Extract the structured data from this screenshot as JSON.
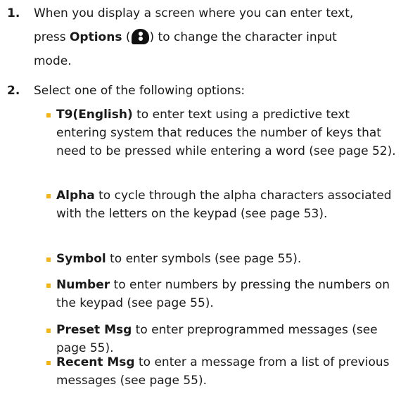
{
  "steps": [
    {
      "number": "1.",
      "text_before": "When you display a screen where you can enter text,",
      "line2_prefix": "press ",
      "options_bold": "Options",
      "paren_open": " (",
      "icon": "menu-softkey-icon",
      "paren_close": ")",
      "line2_suffix": " to change the character input",
      "line3": "mode."
    },
    {
      "number": "2.",
      "text": "Select one of the following options:"
    }
  ],
  "options": [
    {
      "name": "T9(English)",
      "description": " to enter text using a predictive text entering system that reduces the number of keys that need to be pressed while entering a word (see page 52)."
    },
    {
      "name": "Alpha",
      "description": " to cycle through the alpha characters associated with the letters on the keypad (see page 53)."
    },
    {
      "name": "Symbol",
      "description": " to enter symbols (see page 55)."
    },
    {
      "name": "Number",
      "description": " to enter numbers by pressing the numbers on the keypad (see page 55)."
    },
    {
      "name": "Preset Msg",
      "description": " to enter preprogrammed messages (see page 55)."
    },
    {
      "name": "Recent Msg",
      "description": " to enter a message from a list of previous messages (see page 55)."
    }
  ],
  "colors": {
    "bullet": "#f2b418",
    "text": "#1a1a1a"
  }
}
